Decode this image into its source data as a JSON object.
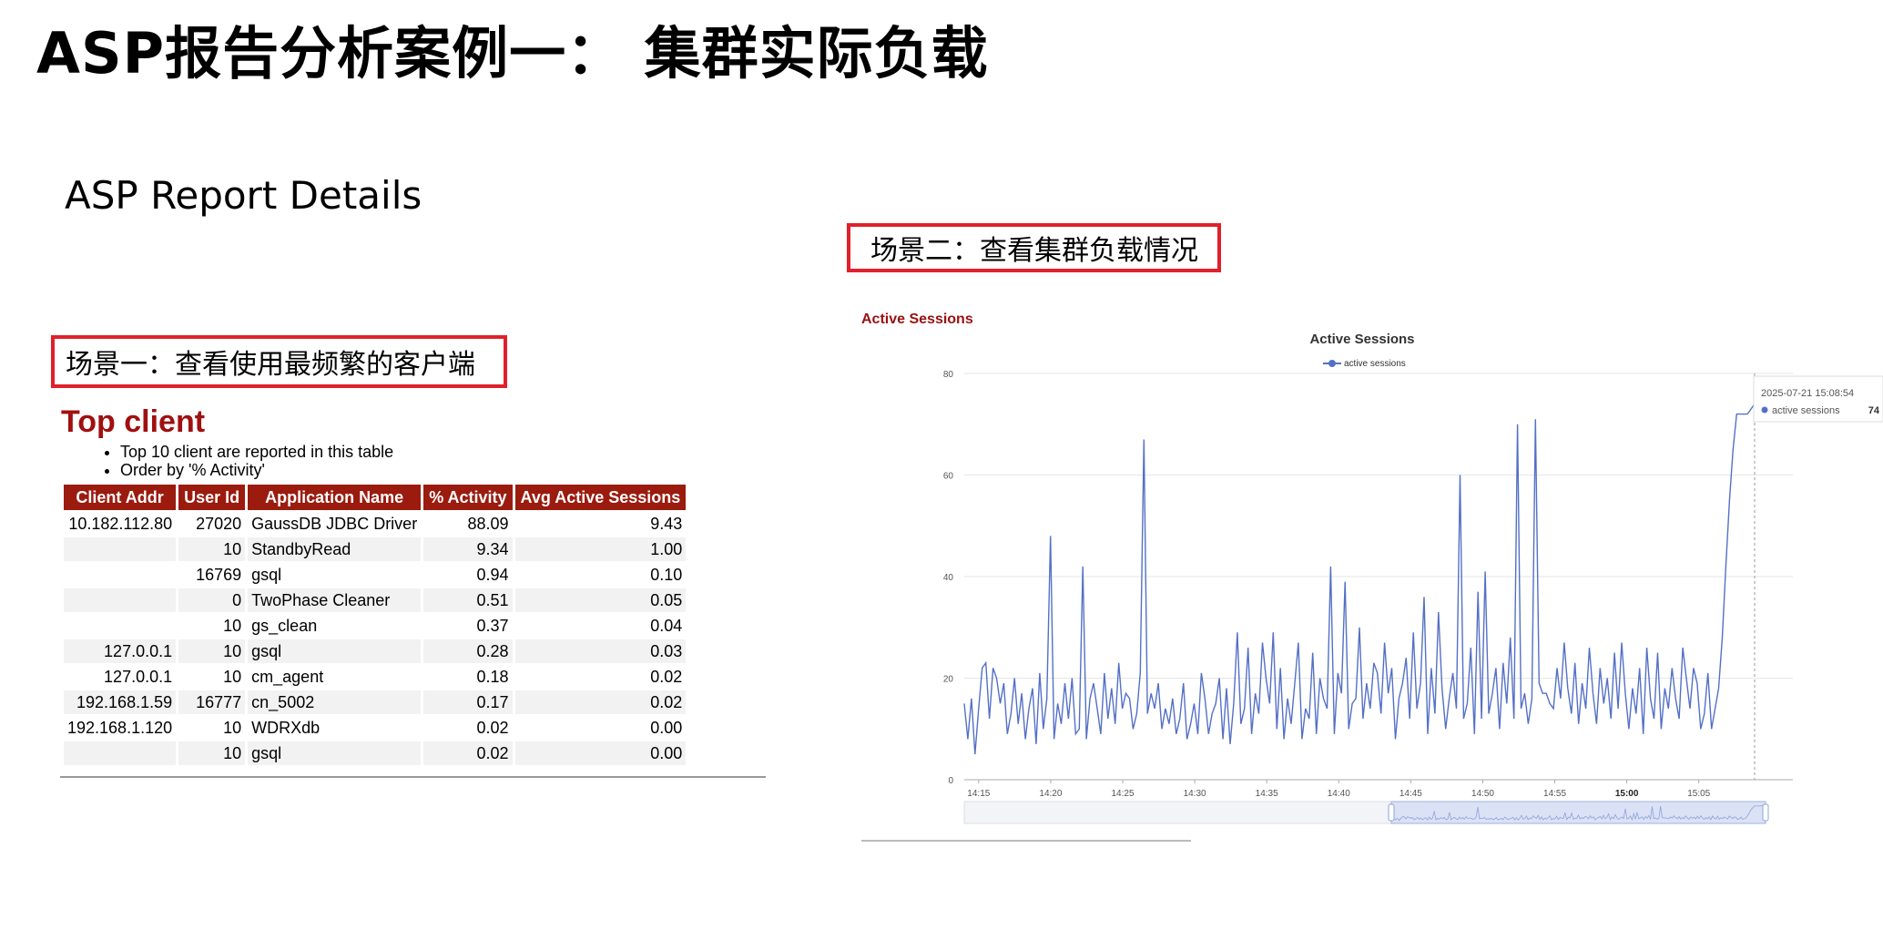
{
  "slide": {
    "title": "ASP报告分析案例一： 集群实际负载",
    "subtitle": "ASP Report Details",
    "scenario_1": "场景一：查看使用最频繁的客户端",
    "scenario_2": "场景二：查看集群负载情况"
  },
  "top_client": {
    "heading": "Top client",
    "notes": [
      "Top 10 client are reported in this table",
      "Order by '% Activity'"
    ],
    "columns": [
      "Client Addr",
      "User Id",
      "Application Name",
      "% Activity",
      "Avg Active Sessions"
    ],
    "rows": [
      [
        "10.182.112.80",
        "27020",
        "GaussDB JDBC Driver",
        "88.09",
        "9.43"
      ],
      [
        "",
        "10",
        "StandbyRead",
        "9.34",
        "1.00"
      ],
      [
        "",
        "16769",
        "gsql",
        "0.94",
        "0.10"
      ],
      [
        "",
        "0",
        "TwoPhase Cleaner",
        "0.51",
        "0.05"
      ],
      [
        "",
        "10",
        "gs_clean",
        "0.37",
        "0.04"
      ],
      [
        "127.0.0.1",
        "10",
        "gsql",
        "0.28",
        "0.03"
      ],
      [
        "127.0.0.1",
        "10",
        "cm_agent",
        "0.18",
        "0.02"
      ],
      [
        "192.168.1.59",
        "16777",
        "cn_5002",
        "0.17",
        "0.02"
      ],
      [
        "192.168.1.120",
        "10",
        "WDRXdb",
        "0.02",
        "0.00"
      ],
      [
        "",
        "10",
        "gsql",
        "0.02",
        "0.00"
      ]
    ]
  },
  "active_sessions_section": {
    "heading": "Active Sessions"
  },
  "chart_data": {
    "type": "line",
    "title": "Active Sessions",
    "series": [
      {
        "name": "active sessions",
        "color": "#5470c6",
        "values": [
          15,
          8,
          16,
          5,
          14,
          22,
          23,
          12,
          22,
          20,
          15,
          19,
          9,
          13,
          20,
          11,
          17,
          8,
          14,
          18,
          7,
          21,
          10,
          16,
          48,
          8,
          15,
          11,
          19,
          12,
          20,
          9,
          10,
          42,
          8,
          16,
          19,
          14,
          9,
          21,
          12,
          18,
          11,
          23,
          14,
          17,
          16,
          10,
          13,
          21,
          67,
          13,
          17,
          14,
          19,
          10,
          14,
          11,
          16,
          9,
          12,
          19,
          8,
          11,
          15,
          9,
          21,
          16,
          9,
          13,
          15,
          20,
          8,
          18,
          7,
          15,
          29,
          11,
          14,
          26,
          9,
          17,
          13,
          27,
          20,
          15,
          29,
          10,
          22,
          8,
          16,
          11,
          19,
          27,
          8,
          14,
          12,
          25,
          9,
          20,
          16,
          14,
          42,
          9,
          21,
          17,
          39,
          10,
          15,
          16,
          30,
          12,
          19,
          14,
          23,
          21,
          13,
          27,
          17,
          22,
          8,
          16,
          19,
          24,
          12,
          29,
          14,
          19,
          36,
          9,
          22,
          13,
          33,
          18,
          10,
          16,
          21,
          14,
          60,
          12,
          15,
          26,
          9,
          37,
          12,
          41,
          13,
          17,
          22,
          10,
          23,
          15,
          28,
          12,
          70,
          14,
          17,
          11,
          16,
          71,
          19,
          17,
          17,
          15,
          14,
          22,
          16,
          27,
          18,
          13,
          23,
          11,
          19,
          14,
          26,
          17,
          11,
          22,
          15,
          20,
          12,
          25,
          14,
          27,
          17,
          10,
          18,
          13,
          22,
          9,
          26,
          16,
          12,
          25,
          10,
          18,
          14,
          22,
          16,
          12,
          26,
          20,
          14,
          22,
          19,
          10,
          13,
          21,
          10,
          14,
          18,
          28,
          42,
          55,
          65,
          72,
          72,
          72,
          72,
          73,
          74
        ]
      }
    ],
    "xlabel": "",
    "ylabel": "",
    "x_tick_labels": [
      "14:15",
      "14:20",
      "14:25",
      "14:30",
      "14:35",
      "14:40",
      "14:45",
      "14:50",
      "14:55",
      "15:00",
      "15:05"
    ],
    "x_range": [
      "14:14",
      "15:09"
    ],
    "ylim": [
      0,
      80
    ],
    "y_ticks": [
      0,
      20,
      40,
      60,
      80
    ],
    "legend": "top-center",
    "grid": "horizontal",
    "tooltip": {
      "time": "2025-07-21 15:08:54",
      "series": "active sessions",
      "value": 74
    },
    "zoom_slider": true
  }
}
